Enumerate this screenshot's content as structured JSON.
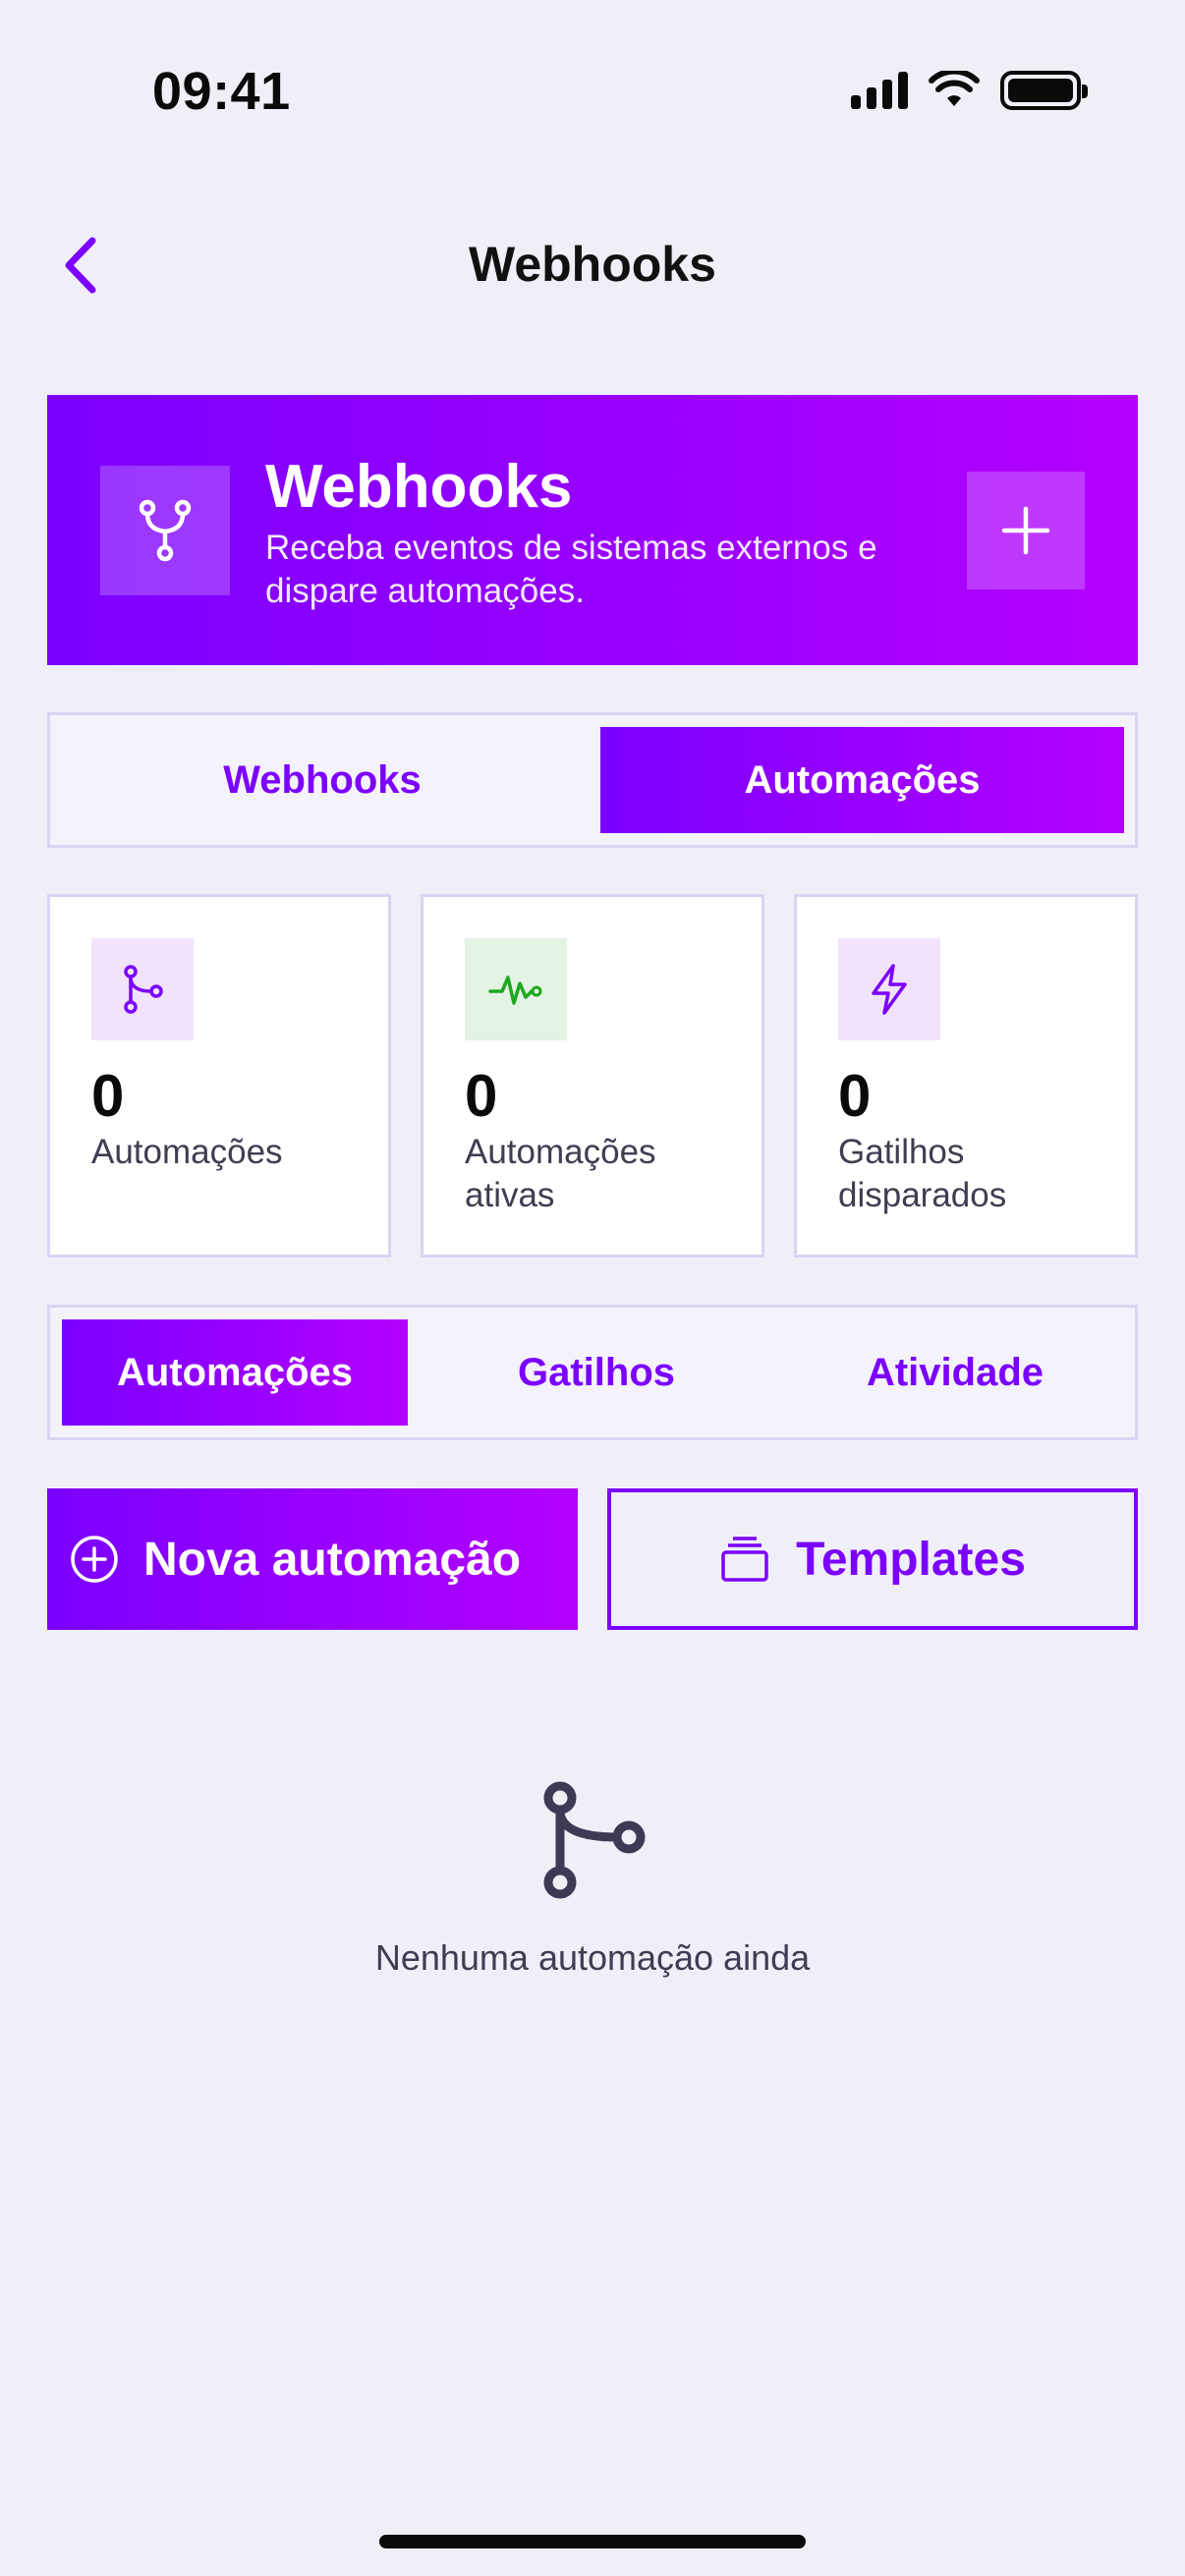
{
  "status_bar": {
    "time": "09:41"
  },
  "nav": {
    "title": "Webhooks"
  },
  "hero": {
    "title": "Webhooks",
    "subtitle": "Receba eventos de sistemas externos e dispare automações."
  },
  "main_tabs": [
    {
      "label": "Webhooks",
      "selected": false
    },
    {
      "label": "Automações",
      "selected": true
    }
  ],
  "stats": [
    {
      "value": "0",
      "label": "Automações",
      "icon": "branch-icon",
      "icon_bg": "#F1E3FB",
      "icon_color": "#7B00FF"
    },
    {
      "value": "0",
      "label": "Automações ativas",
      "icon": "activity-icon",
      "icon_bg": "#E5F3E5",
      "icon_color": "#1DA81D"
    },
    {
      "value": "0",
      "label": "Gatilhos disparados",
      "icon": "zap-icon",
      "icon_bg": "#F1E3FB",
      "icon_color": "#7B00FF"
    }
  ],
  "sub_tabs": [
    {
      "label": "Automações",
      "selected": true
    },
    {
      "label": "Gatilhos",
      "selected": false
    },
    {
      "label": "Atividade",
      "selected": false
    }
  ],
  "actions": {
    "new_automation": "Nova automação",
    "templates": "Templates"
  },
  "empty_state": {
    "text": "Nenhuma automação ainda"
  },
  "colors": {
    "accent": "#7B00FF",
    "accent_end": "#B300FF",
    "background": "#F0EFF8"
  }
}
